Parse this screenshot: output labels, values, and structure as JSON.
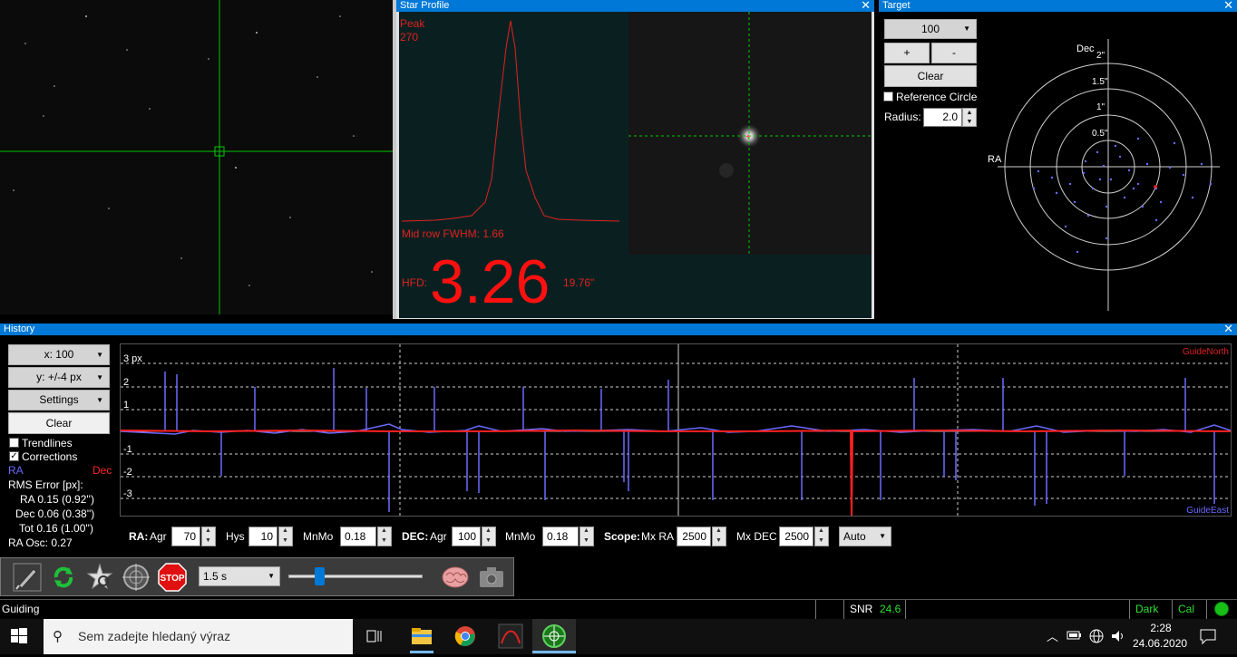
{
  "star_profile": {
    "title": "Star Profile",
    "peak_label": "Peak",
    "peak_value": "270",
    "fwhm": "Mid row FWHM: 1.66",
    "hfd_label": "HFD:",
    "hfd_value": "3.26",
    "hfd_arcsec": "19.76\""
  },
  "target": {
    "title": "Target",
    "scale_value": "100",
    "plus_label": "+",
    "minus_label": "-",
    "clear_label": "Clear",
    "reference_circle_label": "Reference Circle",
    "radius_label": "Radius:",
    "radius_value": "2.0",
    "dec_label": "Dec",
    "ra_label": "RA",
    "ring_labels": [
      "2\"",
      "1.5\"",
      "1\"",
      "0.5\""
    ]
  },
  "history": {
    "title": "History",
    "x_select": "x: 100",
    "y_select": "y: +/-4 px",
    "settings_label": "Settings",
    "clear_label": "Clear",
    "trendlines_label": "Trendlines",
    "trendlines_checked": false,
    "corrections_label": "Corrections",
    "corrections_checked": true,
    "legend_ra": "RA",
    "legend_dec": "Dec",
    "rms_title": "RMS Error [px]:",
    "rms_ra": "RA  0.15 (0.92'')",
    "rms_dec": "Dec  0.06 (0.38'')",
    "rms_tot": "Tot  0.16 (1.00'')",
    "ra_osc": "RA Osc: 0.27",
    "y_ticks": [
      "3 px",
      "2",
      "1",
      "-1",
      "-2",
      "-3"
    ],
    "guide_north": "GuideNorth",
    "guide_east": "GuideEast",
    "colors": {
      "ra": "#6a6aff",
      "dec": "#ff2020"
    }
  },
  "params": {
    "ra_label": "RA:",
    "agr_label": "Agr",
    "ra_agr": "70",
    "hys_label": "Hys",
    "hys_value": "10",
    "mnmo_label": "MnMo",
    "ra_mnmo": "0.18",
    "dec_label": "DEC:",
    "dec_agr_label": "Agr",
    "dec_agr": "100",
    "dec_mnmo_label": "MnMo",
    "dec_mnmo": "0.18",
    "scope_label": "Scope:",
    "mxra_label": "Mx RA",
    "mxra_value": "2500",
    "mxdec_label": "Mx DEC",
    "mxdec_value": "2500",
    "mode_value": "Auto"
  },
  "toolbar": {
    "exposure": "1.5 s"
  },
  "statusbar": {
    "state": "Guiding",
    "snr_label": "SNR",
    "snr_value": "24.6",
    "dark_label": "Dark",
    "cal_label": "Cal"
  },
  "taskbar": {
    "search_placeholder": "Sem zadejte hledaný výraz",
    "time": "2:28",
    "date": "24.06.2020"
  }
}
